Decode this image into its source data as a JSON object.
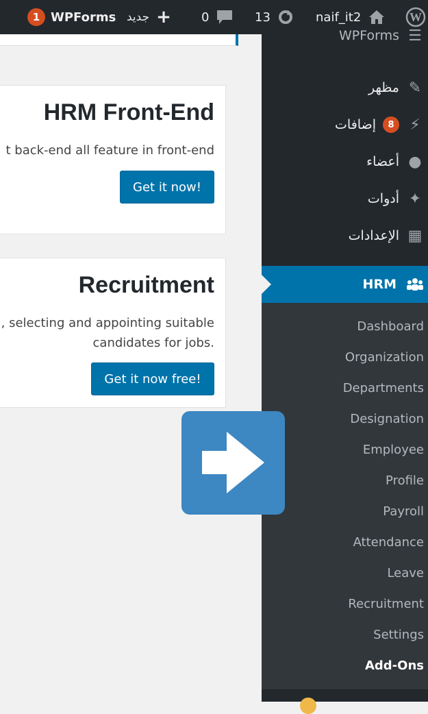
{
  "adminbar": {
    "wpforms_badge": "1",
    "wpforms_label": "WPForms",
    "new_label": "جديد",
    "comments_count": "0",
    "updates_count": "13",
    "user_label": "naif_it2"
  },
  "content": {
    "cards": [
      {
        "title": "HRM Front-End",
        "description": "t back-end all feature in front-end",
        "button": "Get it now!"
      },
      {
        "title": "Recruitment",
        "description_line1": ", selecting and appointing suitable",
        "description_line2": "candidates for jobs.",
        "button": "Get it now free!"
      }
    ]
  },
  "sidebar": {
    "top_partial": "WPForms",
    "items": [
      {
        "label": "مظهر",
        "icon": "brush-icon"
      },
      {
        "label": "إضافات",
        "icon": "plugin-icon",
        "badge": "8"
      },
      {
        "label": "أعضاء",
        "icon": "user-icon"
      },
      {
        "label": "أدوات",
        "icon": "wrench-icon"
      },
      {
        "label": "الإعدادات",
        "icon": "settings-icon"
      }
    ],
    "hrm_label": "HRM",
    "submenu": [
      "Dashboard",
      "Organization",
      "Departments",
      "Designation",
      "Employee",
      "Profile",
      "Payroll",
      "Attendance",
      "Leave",
      "Recruitment",
      "Settings",
      "Add-Ons"
    ]
  },
  "overlay": {
    "icon": "arrow-right-icon",
    "color": "#3d87c2"
  },
  "colors": {
    "adminbar": "#23282d",
    "accent": "#0073aa",
    "badge": "#d54e21"
  }
}
